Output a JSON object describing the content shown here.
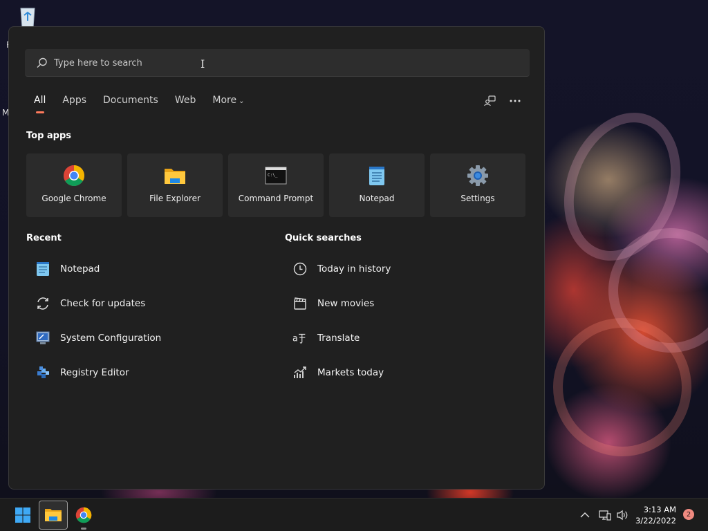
{
  "search": {
    "placeholder": "Type here to search"
  },
  "tabs": [
    {
      "label": "All",
      "active": true
    },
    {
      "label": "Apps"
    },
    {
      "label": "Documents"
    },
    {
      "label": "Web"
    },
    {
      "label": "More"
    }
  ],
  "top_apps": {
    "title": "Top apps",
    "items": [
      {
        "label": "Google Chrome",
        "icon": "chrome-icon"
      },
      {
        "label": "File Explorer",
        "icon": "folder-icon"
      },
      {
        "label": "Command Prompt",
        "icon": "terminal-icon"
      },
      {
        "label": "Notepad",
        "icon": "notepad-icon"
      },
      {
        "label": "Settings",
        "icon": "gear-icon"
      }
    ]
  },
  "recent": {
    "title": "Recent",
    "items": [
      {
        "label": "Notepad",
        "icon": "notepad-icon"
      },
      {
        "label": "Check for updates",
        "icon": "refresh-icon"
      },
      {
        "label": "System Configuration",
        "icon": "system-config-icon"
      },
      {
        "label": "Registry Editor",
        "icon": "registry-icon"
      }
    ]
  },
  "quick_searches": {
    "title": "Quick searches",
    "items": [
      {
        "label": "Today in history",
        "icon": "clock-icon"
      },
      {
        "label": "New movies",
        "icon": "clapperboard-icon"
      },
      {
        "label": "Translate",
        "icon": "translate-icon"
      },
      {
        "label": "Markets today",
        "icon": "chart-up-icon"
      }
    ]
  },
  "taskbar": {
    "time": "3:13 AM",
    "date": "3/22/2022",
    "notification_count": "2"
  },
  "desktop": {
    "letter_1": "R",
    "letter_2": "M"
  },
  "colors": {
    "accent": "#ff7a5c",
    "panel_bg": "#202020",
    "tile_bg": "#2b2b2b"
  }
}
